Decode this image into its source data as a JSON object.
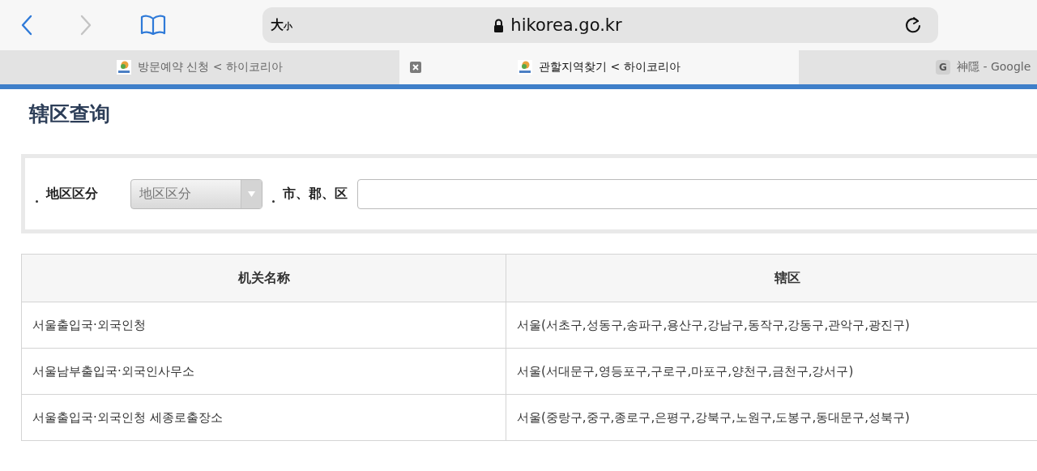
{
  "toolbar": {
    "text_size": {
      "large": "大",
      "small": "小"
    },
    "address": "hikorea.go.kr"
  },
  "tabs": [
    {
      "title": "방문예약 신청 < 하이코리아",
      "selected": false,
      "kind": "site"
    },
    {
      "title": "관할지역찾기 < 하이코리아",
      "selected": true,
      "kind": "site"
    },
    {
      "title": "神隱 - Google",
      "selected": false,
      "kind": "letter",
      "icon_letter": "G"
    }
  ],
  "page": {
    "title": "辖区查询",
    "filter": {
      "region_label": "地区区分",
      "region_select": "地区区分",
      "city_label": "市、郡、区"
    },
    "table": {
      "columns": [
        "机关名称",
        "辖区"
      ],
      "rows": [
        [
          "서울출입국·외국인청",
          "서울(서초구,성동구,송파구,용산구,강남구,동작구,강동구,관악구,광진구)"
        ],
        [
          "서울남부출입국·외국인사무소",
          "서울(서대문구,영등포구,구로구,마포구,양천구,금천구,강서구)"
        ],
        [
          "서울출입국·외국인청 세종로출장소",
          "서울(중랑구,중구,종로구,은평구,강북구,노원구,도봉구,동대문구,성북구)"
        ]
      ]
    }
  }
}
